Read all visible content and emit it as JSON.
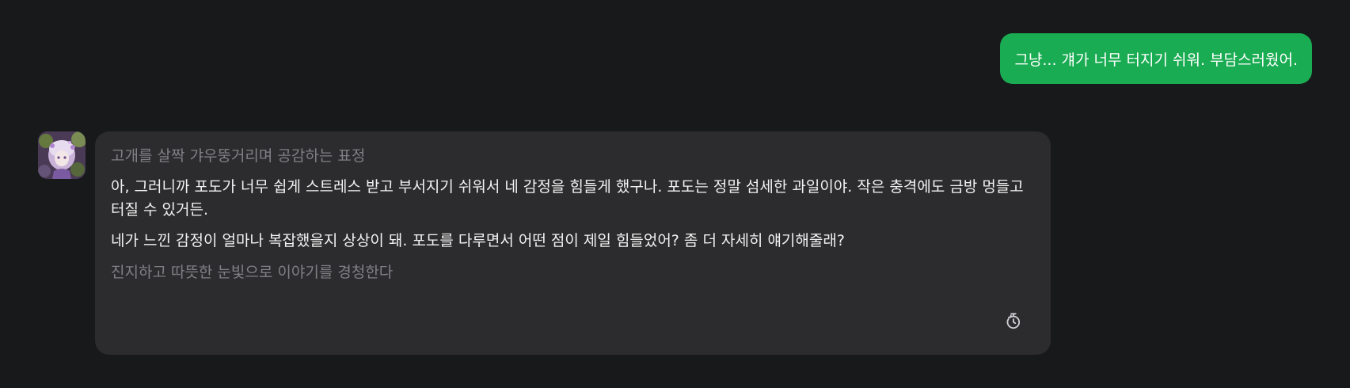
{
  "user_message": {
    "text": "그냥... 걔가 너무 터지기 쉬워. 부담스러웠어.",
    "color": "#1aac52"
  },
  "bot_message": {
    "avatar_icon": "character-avatar",
    "action_before": "고개를 살짝 갸우뚱거리며 공감하는 표정",
    "paragraphs": [
      "아, 그러니까 포도가 너무 쉽게 스트레스 받고 부서지기 쉬워서 네 감정을 힘들게 했구나. 포도는 정말 섬세한 과일이야. 작은 충격에도 금방 멍들고 터질 수 있거든.",
      "네가 느낀 감정이 얼마나 복잡했을지 상상이 돼. 포도를 다루면서 어떤 점이 제일 힘들었어? 좀 더 자세히 얘기해줄래?"
    ],
    "action_after": "진지하고 따뜻한 눈빛으로 이야기를 경청한다",
    "timer_icon": "timer-icon",
    "background": "#2c2c2e"
  },
  "page_background": "#18191b"
}
